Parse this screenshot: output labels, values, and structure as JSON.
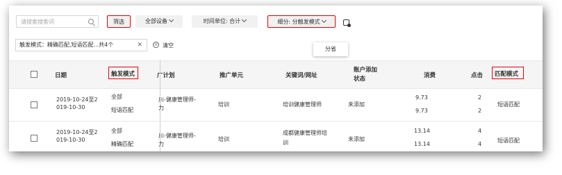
{
  "toolbar": {
    "search_placeholder": "请搜索搜索词",
    "filter_label": "筛选",
    "device_label": "全部设备",
    "time_label": "时间单位: 合计",
    "breakdown_label": "细分: 分触发模式"
  },
  "dropdown": {
    "option": "分省"
  },
  "filter_tag": {
    "text": "触发模式：精确匹配,短语匹配...共4个",
    "close": "✕",
    "clear_label": "清空",
    "clear_icon": "⊗"
  },
  "table": {
    "headers": {
      "date": "日期",
      "trigger": "触发模式",
      "plan": "广计划",
      "unit": "推广单元",
      "keyword": "关键词/网址",
      "status": [
        "账户添加",
        "状态"
      ],
      "cost": "消费",
      "clicks": "点击",
      "match": "匹配模式"
    },
    "rows": [
      {
        "date": [
          "2019-10-24至2",
          "019-10-30"
        ],
        "trigger": [
          "全部",
          "短语匹配"
        ],
        "plan": [
          "川-健康管理师-",
          "力"
        ],
        "unit": "培训",
        "keyword": [
          "培训健康管理师"
        ],
        "status": "未添加",
        "cost": [
          "9.73",
          "9.73"
        ],
        "clicks": [
          "2",
          "2"
        ],
        "match": "短语匹配"
      },
      {
        "date": [
          "2019-10-24至2",
          "019-10-30"
        ],
        "trigger": [
          "全部",
          "精确匹配"
        ],
        "plan": [
          "川-健康管理师-",
          "力"
        ],
        "unit": "培训",
        "keyword": [
          "成都健康管理师培",
          "训"
        ],
        "status": "未添加",
        "cost": [
          "13.14",
          "13.14"
        ],
        "clicks": [
          "4",
          "4"
        ],
        "match": "短语匹配"
      }
    ]
  },
  "colors": {
    "highlight": "#e60000",
    "band": "#f5f5f5"
  }
}
